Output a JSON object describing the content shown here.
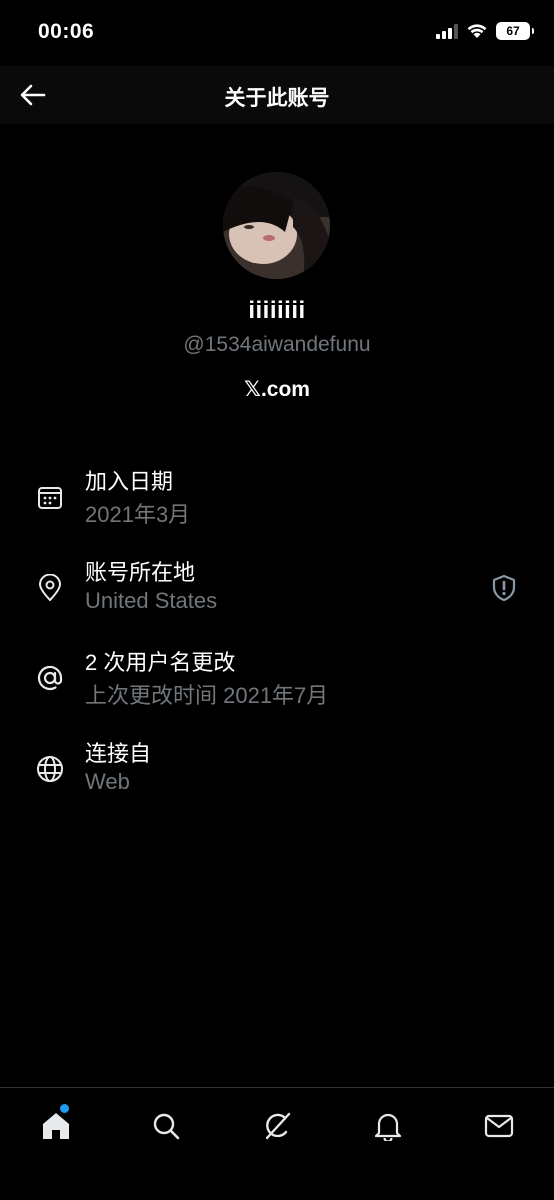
{
  "status_bar": {
    "time": "00:06",
    "battery": "67"
  },
  "header": {
    "title": "关于此账号"
  },
  "profile": {
    "display_name": "iiiiiiii",
    "handle": "@1534aiwandefunu",
    "site": "𝕏.com"
  },
  "info": [
    {
      "icon": "calendar-icon",
      "title": "加入日期",
      "subtitle": "2021年3月"
    },
    {
      "icon": "location-pin-icon",
      "title": "账号所在地",
      "subtitle": "United States",
      "badge": "shield-alert-icon"
    },
    {
      "icon": "at-sign-icon",
      "title": "2 次用户名更改",
      "subtitle": "上次更改时间 2021年7月"
    },
    {
      "icon": "globe-icon",
      "title": "连接自",
      "subtitle": "Web"
    }
  ],
  "bottom_nav": {
    "items": [
      "home-icon",
      "search-icon",
      "grok-icon",
      "notifications-icon",
      "messages-icon"
    ]
  },
  "colors": {
    "background": "#000000",
    "primary_text": "#ffffff",
    "secondary_text": "#71767b",
    "accent": "#1d9bf0"
  }
}
